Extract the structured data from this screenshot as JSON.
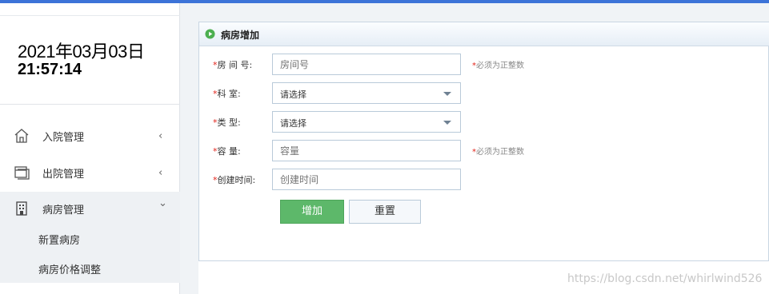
{
  "clock": {
    "date": "2021年03月03日",
    "time": "21:57:14"
  },
  "sidebar": {
    "items": [
      {
        "label": "入院管理",
        "chevron": "‹",
        "icon": "home-icon"
      },
      {
        "label": "出院管理",
        "chevron": "‹",
        "icon": "window-icon"
      },
      {
        "label": "病房管理",
        "chevron": "⌄",
        "icon": "building-icon"
      }
    ],
    "sub_items": [
      {
        "label": "新置病房"
      },
      {
        "label": "病房价格调整"
      }
    ]
  },
  "panel": {
    "title": "病房增加",
    "title_icon": "play-circle-icon",
    "fields": [
      {
        "label": "房 间 号:",
        "type": "input",
        "placeholder": "房间号",
        "hint": "必须为正整数"
      },
      {
        "label": "科    室:",
        "type": "select",
        "value": "请选择"
      },
      {
        "label": "类    型:",
        "type": "select",
        "value": "请选择"
      },
      {
        "label": "容    量:",
        "type": "input",
        "placeholder": "容量",
        "hint": "必须为正整数"
      },
      {
        "label": "创建时间:",
        "type": "input",
        "placeholder": "创建时间"
      }
    ],
    "required_mark": "*",
    "add_button": "增加",
    "reset_button": "重置"
  },
  "watermark": "https://blog.csdn.net/whirlwind526",
  "colors": {
    "accent": "#3c73d8",
    "add_button": "#5db86a",
    "required": "#e2231a"
  }
}
